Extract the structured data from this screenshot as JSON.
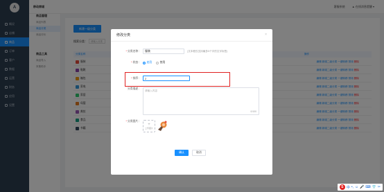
{
  "sidebar": {
    "logo": "A",
    "items": [
      {
        "label": "概况",
        "active": false
      },
      {
        "label": "店铺",
        "active": false
      },
      {
        "label": "商品",
        "active": true
      },
      {
        "label": "订单",
        "active": false
      },
      {
        "label": "客户",
        "active": false
      },
      {
        "label": "数据",
        "active": false
      },
      {
        "label": "运营",
        "active": false
      },
      {
        "label": "财务",
        "active": false
      },
      {
        "label": "应用",
        "active": false
      },
      {
        "label": "设置",
        "active": false
      }
    ]
  },
  "subnav": {
    "groups": [
      {
        "title": "商品管理",
        "items": [
          {
            "label": "商品列表",
            "active": false
          },
          {
            "label": "商品分类",
            "active": true
          },
          {
            "label": "商品评价",
            "active": false
          }
        ]
      },
      {
        "title": "商品工具",
        "items": [
          {
            "label": "商品导入",
            "active": false
          },
          {
            "label": "采集助手",
            "active": false
          }
        ]
      }
    ]
  },
  "header": {
    "title": "移动商城",
    "links": [
      "客服系统",
      "▲ 在线消息提醒 ▾"
    ]
  },
  "main": {
    "new_button": "新建一级分类",
    "filter_label": "搜索分类：",
    "filter_placeholder": "请输入分类",
    "table_headers": [
      "分类名称",
      "操作"
    ],
    "rows": [
      {
        "name": "服装",
        "color": "#e74c3c"
      },
      {
        "name": "鞋靴",
        "color": "#8e44ad"
      },
      {
        "name": "箱包",
        "color": "#f39c12"
      },
      {
        "name": "家电",
        "color": "#3498db"
      },
      {
        "name": "家居",
        "color": "#2ecc71"
      },
      {
        "name": "母婴",
        "color": "#e67e22"
      },
      {
        "name": "美妆",
        "color": "#9b59b6"
      },
      {
        "name": "食品",
        "color": "#16a085"
      },
      {
        "name": "书籍",
        "color": "#34495e"
      }
    ],
    "ops": {
      "edit": "编辑",
      "add_child": "新增二级分类",
      "transfer": "一键转移",
      "disable": "禁用",
      "delete": "删除"
    }
  },
  "modal": {
    "title": "修改分类",
    "close": "×",
    "name_label": "分类名称：",
    "name_value": "服装",
    "name_hint": "(文本框仅支持最多5个字的文字标签)",
    "status_label": "状态：",
    "status_options": [
      {
        "label": "启用",
        "checked": true
      },
      {
        "label": "禁用",
        "checked": false
      }
    ],
    "sort_label": "排序：",
    "sort_value": "2",
    "desc_label": "分类描述：",
    "desc_placeholder": "请输入内容",
    "desc_count": "0/100",
    "image_label": "分类图片：",
    "upload_plus": "+",
    "upload_label": "上传图片",
    "ok": "确认",
    "cancel": "取消"
  },
  "tray": {
    "items": [
      "S",
      "中",
      "•,",
      "☺",
      "🎤",
      "⌨",
      "👕",
      "✂"
    ]
  },
  "colors": {
    "primary": "#1890ff",
    "sidebar": "#2c3e50",
    "highlight": "#e02020",
    "danger": "#f5222d"
  }
}
